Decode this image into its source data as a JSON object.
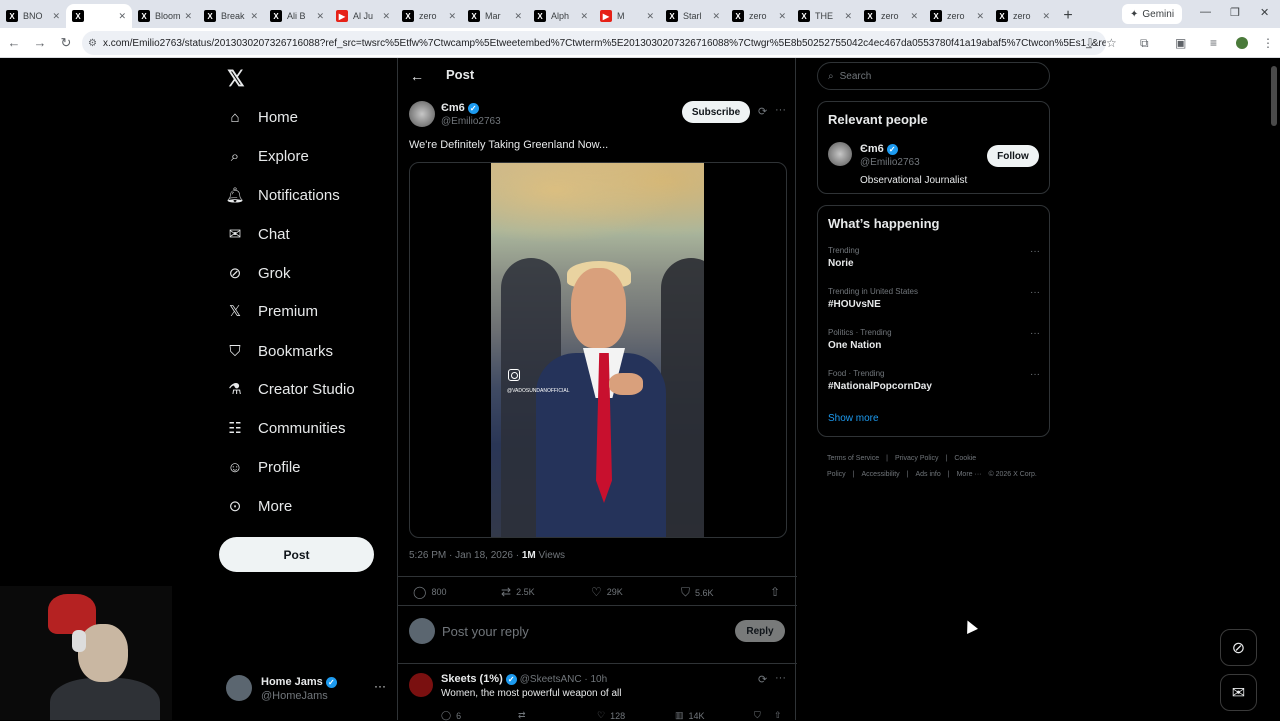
{
  "browser": {
    "tabs": [
      {
        "icon": "x",
        "label": "BNO"
      },
      {
        "icon": "x",
        "label": "",
        "active": true
      },
      {
        "icon": "x",
        "label": "Bloom"
      },
      {
        "icon": "x",
        "label": "Break"
      },
      {
        "icon": "x",
        "label": "Ali B"
      },
      {
        "icon": "yt",
        "label": "Al Ju"
      },
      {
        "icon": "x",
        "label": "zero"
      },
      {
        "icon": "x",
        "label": "Mar"
      },
      {
        "icon": "x",
        "label": "Alph"
      },
      {
        "icon": "yt",
        "label": "M"
      },
      {
        "icon": "x",
        "label": "Starl"
      },
      {
        "icon": "x",
        "label": "zero"
      },
      {
        "icon": "x",
        "label": "THE"
      },
      {
        "icon": "x",
        "label": "zero"
      },
      {
        "icon": "x",
        "label": "zero"
      },
      {
        "icon": "x",
        "label": "zero"
      }
    ],
    "new_tab": "+",
    "gemini_label": "Gemini",
    "url": "x.com/Emilio2763/status/2013030207326716088?ref_src=twsrc%5Etfw%7Ctwcamp%5Etweetembed%7Ctwterm%5E2013030207326716088%7Ctwgr%5E8b50252755042c4ec467da0553780f41a19abaf5%7Ctwcon%5Es1_&ref_url=http%3..."
  },
  "nav": {
    "items": [
      {
        "label": "Home",
        "icon": "home-icon"
      },
      {
        "label": "Explore",
        "icon": "search-icon"
      },
      {
        "label": "Notifications",
        "icon": "bell-icon"
      },
      {
        "label": "Chat",
        "icon": "mail-icon"
      },
      {
        "label": "Grok",
        "icon": "grok-icon"
      },
      {
        "label": "Premium",
        "icon": "x-icon"
      },
      {
        "label": "Bookmarks",
        "icon": "bookmark-icon"
      },
      {
        "label": "Creator Studio",
        "icon": "flask-icon"
      },
      {
        "label": "Communities",
        "icon": "people-icon"
      },
      {
        "label": "Profile",
        "icon": "person-icon"
      },
      {
        "label": "More",
        "icon": "more-icon"
      }
    ],
    "post_button": "Post",
    "account": {
      "name": "Home Jams",
      "handle": "@HomeJams"
    }
  },
  "post": {
    "header": "Post",
    "author_name": "Єm6",
    "author_handle": "@Emilio2763",
    "subscribe_label": "Subscribe",
    "text": "We're Definitely Taking Greenland Now...",
    "watermark": "@VADOSUNDANOFFICIAL",
    "time": "5:26 PM · Jan 18, 2026 ·",
    "views_count": "1M",
    "views_label": "Views",
    "replies": "800",
    "reposts": "2.5K",
    "likes": "29K",
    "bookmarks": "5.6K"
  },
  "reply_box": {
    "placeholder": "Post your reply",
    "button": "Reply"
  },
  "reply1": {
    "name": "Skeets (1%)",
    "handle": "@SkeetsANC · 10h",
    "text": "Women, the most powerful weapon of all",
    "replies": "6",
    "likes": "128",
    "views": "14K"
  },
  "search": {
    "placeholder": "Search"
  },
  "relevant_people": {
    "title": "Relevant people",
    "name": "Єm6",
    "handle": "@Emilio2763",
    "bio": "Observational Journalist",
    "follow_label": "Follow"
  },
  "happening": {
    "title": "What’s happening",
    "trends": [
      {
        "context": "Trending",
        "name": "Norie"
      },
      {
        "context": "Trending in United States",
        "name": "#HOUvsNE"
      },
      {
        "context": "Politics · Trending",
        "name": "One Nation"
      },
      {
        "context": "Food · Trending",
        "name": "#NationalPopcornDay"
      }
    ],
    "show_more": "Show more"
  },
  "footer": {
    "links": [
      "Terms of Service",
      "|",
      "Privacy Policy",
      "|",
      "Cookie Policy",
      "|",
      "Accessibility",
      "|",
      "Ads info",
      "|",
      "More ···",
      "© 2026 X Corp."
    ]
  },
  "colors": {
    "background": "#000000",
    "text": "#e7e9ea",
    "muted": "#71767b",
    "accent": "#1d9bf0",
    "border": "#2f3336"
  }
}
